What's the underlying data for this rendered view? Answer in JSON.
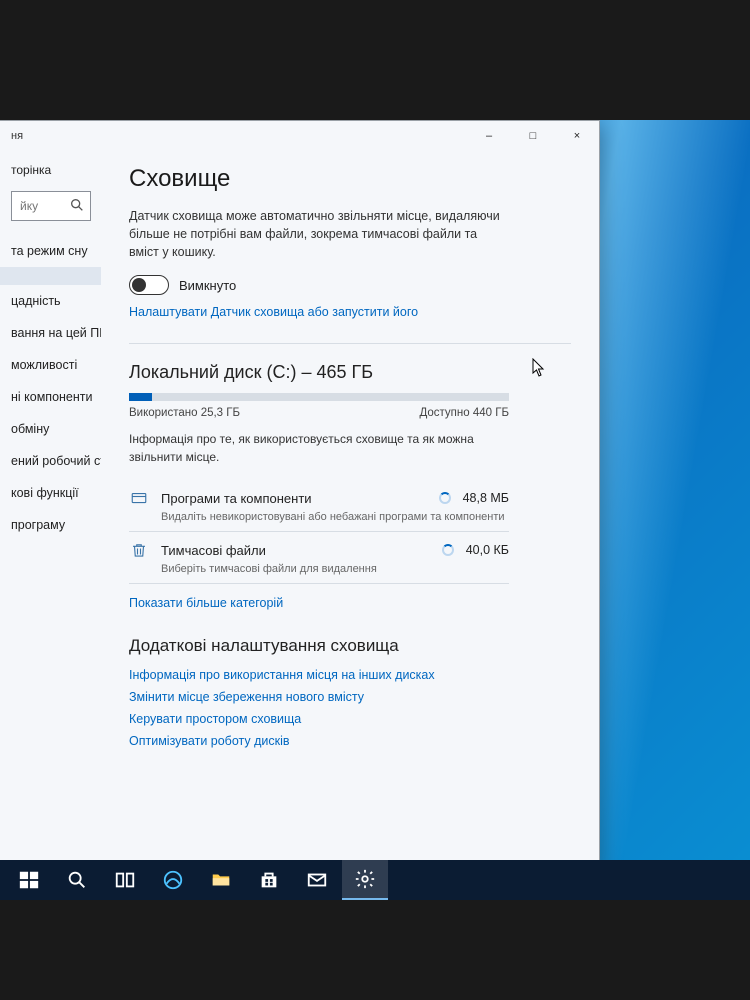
{
  "window": {
    "app_title_fragment": "ня",
    "minimize": "–",
    "maximize": "□",
    "close": "×"
  },
  "sidebar": {
    "home": "торінка",
    "search_placeholder": "йку",
    "items": [
      "та режим сну",
      "",
      "цадність",
      "вання на цей ПК",
      "можливості",
      "ні компоненти",
      "обміну",
      "ений робочий стіл",
      "кові функції",
      "програму"
    ],
    "selected_index": 1
  },
  "page": {
    "title": "Сховище",
    "sense_desc": "Датчик сховища може автоматично звільняти місце, видаляючи більше не потрібні вам файли, зокрема тимчасові файли та вміст у кошику.",
    "toggle_state": "Вимкнуто",
    "configure_link": "Налаштувати Датчик сховища або запустити його",
    "disk_title": "Локальний диск (C:) – 465 ГБ",
    "used_label": "Використано 25,3 ГБ",
    "free_label": "Доступно 440 ГБ",
    "used_percent": 6,
    "info_hint": "Інформація про те, як використовується сховище та як можна звільнити місце.",
    "categories": [
      {
        "name": "Програми та компоненти",
        "size": "48,8 МБ",
        "sub": "Видаліть невикористовувані або небажані програми та компоненти",
        "icon": "apps"
      },
      {
        "name": "Тимчасові файли",
        "size": "40,0 КБ",
        "sub": "Виберіть тимчасові файли для видалення",
        "icon": "trash"
      }
    ],
    "more_link": "Показати більше категорій",
    "more_section": "Додаткові налаштування сховища",
    "more_links": [
      "Інформація про використання місця на інших дисках",
      "Змінити місце збереження нового вмісту",
      "Керувати простором сховища",
      "Оптимізувати роботу дисків"
    ]
  },
  "colors": {
    "accent": "#0067c0"
  }
}
